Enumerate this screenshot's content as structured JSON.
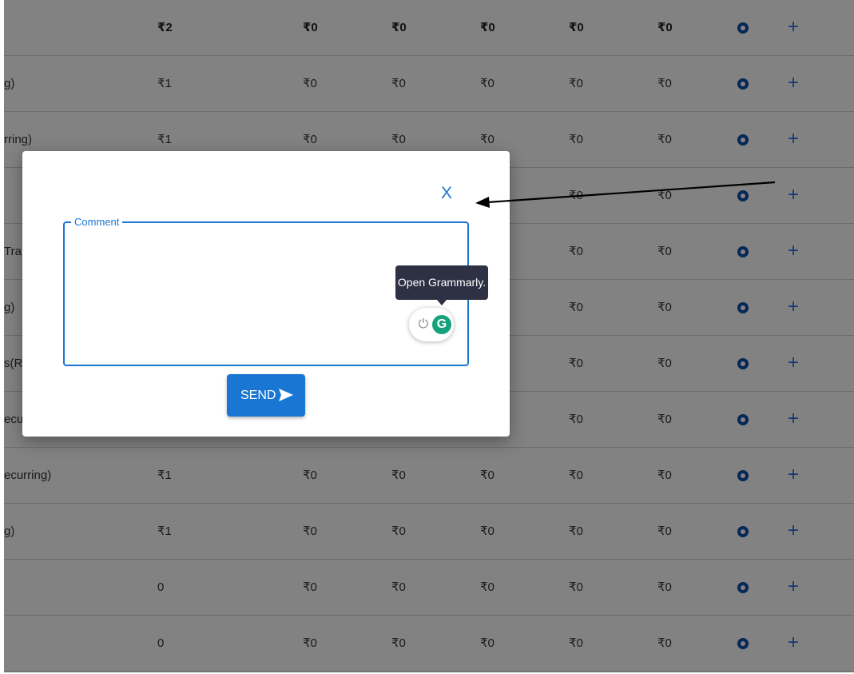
{
  "table": {
    "rows": [
      {
        "label": "",
        "cells": [
          "₹2",
          "₹0",
          "₹0",
          "₹0",
          "₹0",
          "₹0"
        ],
        "header": true
      },
      {
        "label": "g)",
        "cells": [
          "₹1",
          "₹0",
          "₹0",
          "₹0",
          "₹0",
          "₹0"
        ]
      },
      {
        "label": "rring)",
        "cells": [
          "₹1",
          "₹0",
          "₹0",
          "₹0",
          "₹0",
          "₹0"
        ]
      },
      {
        "label": "",
        "cells": [
          "",
          "",
          "",
          "",
          "₹0",
          "₹0"
        ]
      },
      {
        "label": "Tran",
        "cells": [
          "",
          "",
          "",
          "",
          "₹0",
          "₹0"
        ]
      },
      {
        "label": "g)",
        "cells": [
          "",
          "",
          "",
          "",
          "₹0",
          "₹0"
        ]
      },
      {
        "label": "s(Re",
        "cells": [
          "",
          "",
          "",
          "",
          "₹0",
          "₹0"
        ]
      },
      {
        "label": "ecurr",
        "cells": [
          "",
          "",
          "",
          "",
          "₹0",
          "₹0"
        ]
      },
      {
        "label": "ecurring)",
        "cells": [
          "₹1",
          "₹0",
          "₹0",
          "₹0",
          "₹0",
          "₹0"
        ]
      },
      {
        "label": "g)",
        "cells": [
          "₹1",
          "₹0",
          "₹0",
          "₹0",
          "₹0",
          "₹0"
        ]
      },
      {
        "label": "",
        "cells": [
          "0",
          "₹0",
          "₹0",
          "₹0",
          "₹0",
          "₹0"
        ]
      },
      {
        "label": "",
        "cells": [
          "0",
          "₹0",
          "₹0",
          "₹0",
          "₹0",
          "₹0"
        ]
      }
    ],
    "add_glyph": "+",
    "view_icon": "eye-circle-icon",
    "add_icon": "plus-icon"
  },
  "dialog": {
    "close_label": "X",
    "comment_label": "Comment",
    "comment_value": "",
    "send_label": "SEND",
    "send_icon": "send-arrow-icon"
  },
  "grammarly": {
    "tooltip": "Open Grammarly.",
    "power_glyph": "⏻",
    "g_glyph": "G"
  },
  "colors": {
    "accent": "#1976d2",
    "icon_blue": "#0b4ea2",
    "grammarly_green": "#15a37f",
    "tooltip_bg": "#2e3044"
  }
}
